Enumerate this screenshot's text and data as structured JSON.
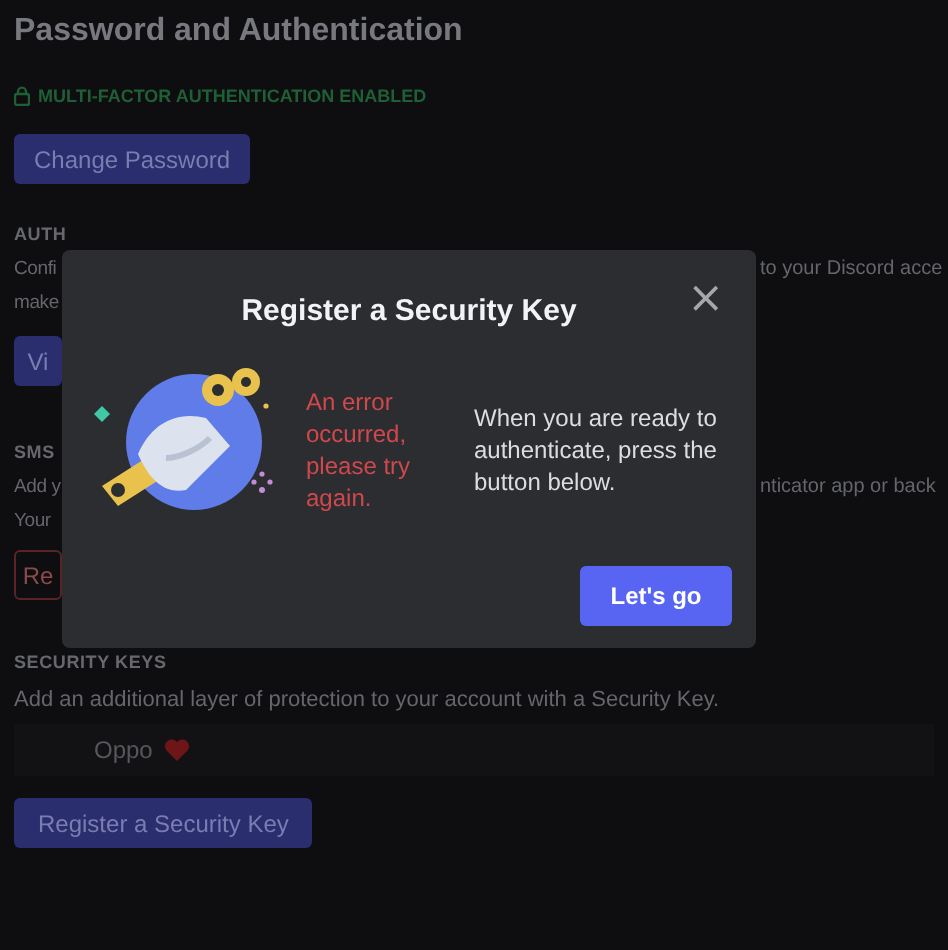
{
  "page": {
    "title": "Password and Authentication",
    "mfa_status": "MULTI-FACTOR AUTHENTICATION ENABLED",
    "change_password_button": "Change Password",
    "authenticator_app": {
      "label": "AUTH",
      "description_left": [
        "Confi",
        "make"
      ],
      "description_right": [
        "to your Discord acce"
      ],
      "button": "Vi"
    },
    "sms": {
      "label": "SMS",
      "description_left": [
        "Add y",
        "Your"
      ],
      "description_right": [
        "nticator app or back"
      ],
      "button": "Re"
    },
    "security_keys": {
      "label": "SECURITY KEYS",
      "description": "Add an additional layer of protection to your account with a Security Key.",
      "keys": [
        {
          "name": "Oppo",
          "kind": "favorite"
        }
      ],
      "button": "Register a Security Key"
    }
  },
  "modal": {
    "title": "Register a Security Key",
    "close": "×",
    "error": "An error occurred, please try again.",
    "message": "When you are ready to authenticate, press the button below.",
    "button": "Let's go"
  }
}
